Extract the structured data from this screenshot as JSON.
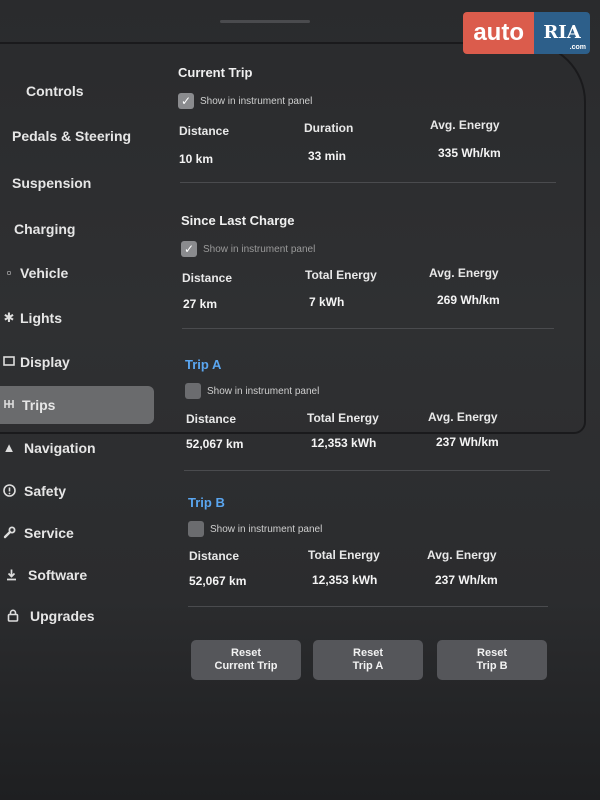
{
  "watermark": {
    "auto": "auto",
    "ria": "RIA",
    "ria_sub": ".com"
  },
  "sidebar": {
    "items": [
      {
        "label": "Controls",
        "icon": "car-icon"
      },
      {
        "label": "Pedals & Steering",
        "icon": "steering-icon"
      },
      {
        "label": "Suspension",
        "icon": "suspension-icon"
      },
      {
        "label": "Charging",
        "icon": "bolt-icon"
      },
      {
        "label": "Vehicle",
        "icon": "vehicle-icon"
      },
      {
        "label": "Lights",
        "icon": "sun-icon"
      },
      {
        "label": "Display",
        "icon": "display-icon"
      },
      {
        "label": "Trips",
        "icon": "trips-icon",
        "active": true
      },
      {
        "label": "Navigation",
        "icon": "navigation-icon"
      },
      {
        "label": "Safety",
        "icon": "safety-icon"
      },
      {
        "label": "Service",
        "icon": "wrench-icon"
      },
      {
        "label": "Software",
        "icon": "download-icon"
      },
      {
        "label": "Upgrades",
        "icon": "lock-icon"
      }
    ]
  },
  "trips": {
    "current": {
      "title": "Current Trip",
      "checkbox_label": "Show in instrument panel",
      "checked": true,
      "labels": [
        "Distance",
        "Duration",
        "Avg. Energy"
      ],
      "values": [
        "10 km",
        "33 min",
        "335 Wh/km"
      ]
    },
    "since_charge": {
      "title": "Since Last Charge",
      "checkbox_label": "Show in instrument panel",
      "checked": true,
      "labels": [
        "Distance",
        "Total Energy",
        "Avg. Energy"
      ],
      "values": [
        "27 km",
        "7 kWh",
        "269 Wh/km"
      ]
    },
    "trip_a": {
      "title": "Trip A",
      "checkbox_label": "Show in instrument panel",
      "checked": false,
      "labels": [
        "Distance",
        "Total Energy",
        "Avg. Energy"
      ],
      "values": [
        "52,067 km",
        "12,353 kWh",
        "237 Wh/km"
      ]
    },
    "trip_b": {
      "title": "Trip B",
      "checkbox_label": "Show in instrument panel",
      "checked": false,
      "labels": [
        "Distance",
        "Total Energy",
        "Avg. Energy"
      ],
      "values": [
        "52,067 km",
        "12,353 kWh",
        "237 Wh/km"
      ]
    }
  },
  "buttons": {
    "reset_current": [
      "Reset",
      "Current Trip"
    ],
    "reset_a": [
      "Reset",
      "Trip A"
    ],
    "reset_b": [
      "Reset",
      "Trip B"
    ]
  },
  "colors": {
    "accent_blue": "#5aa6f0",
    "active_item": "#6a6b6d"
  }
}
